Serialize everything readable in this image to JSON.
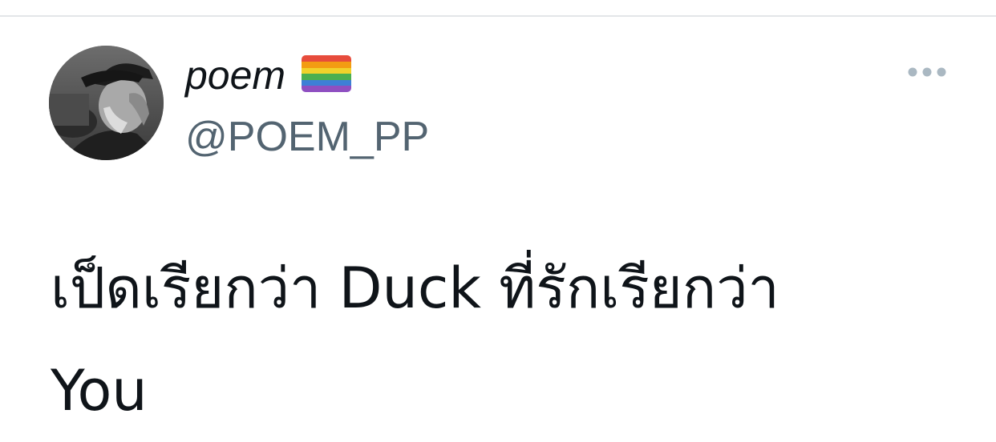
{
  "tweet": {
    "author": {
      "display_name": "poem",
      "handle": "@POEM_PP",
      "flag_emoji": "rainbow-flag-icon"
    },
    "text": "เป็ดเรียกว่า Duck ที่รักเรียกว่า\nYou",
    "more_icon": "more-horizontal-icon"
  },
  "colors": {
    "text_primary": "#0f1419",
    "text_secondary": "#536471",
    "divider": "#e3e6e8",
    "icon_muted": "#8b98a5"
  }
}
